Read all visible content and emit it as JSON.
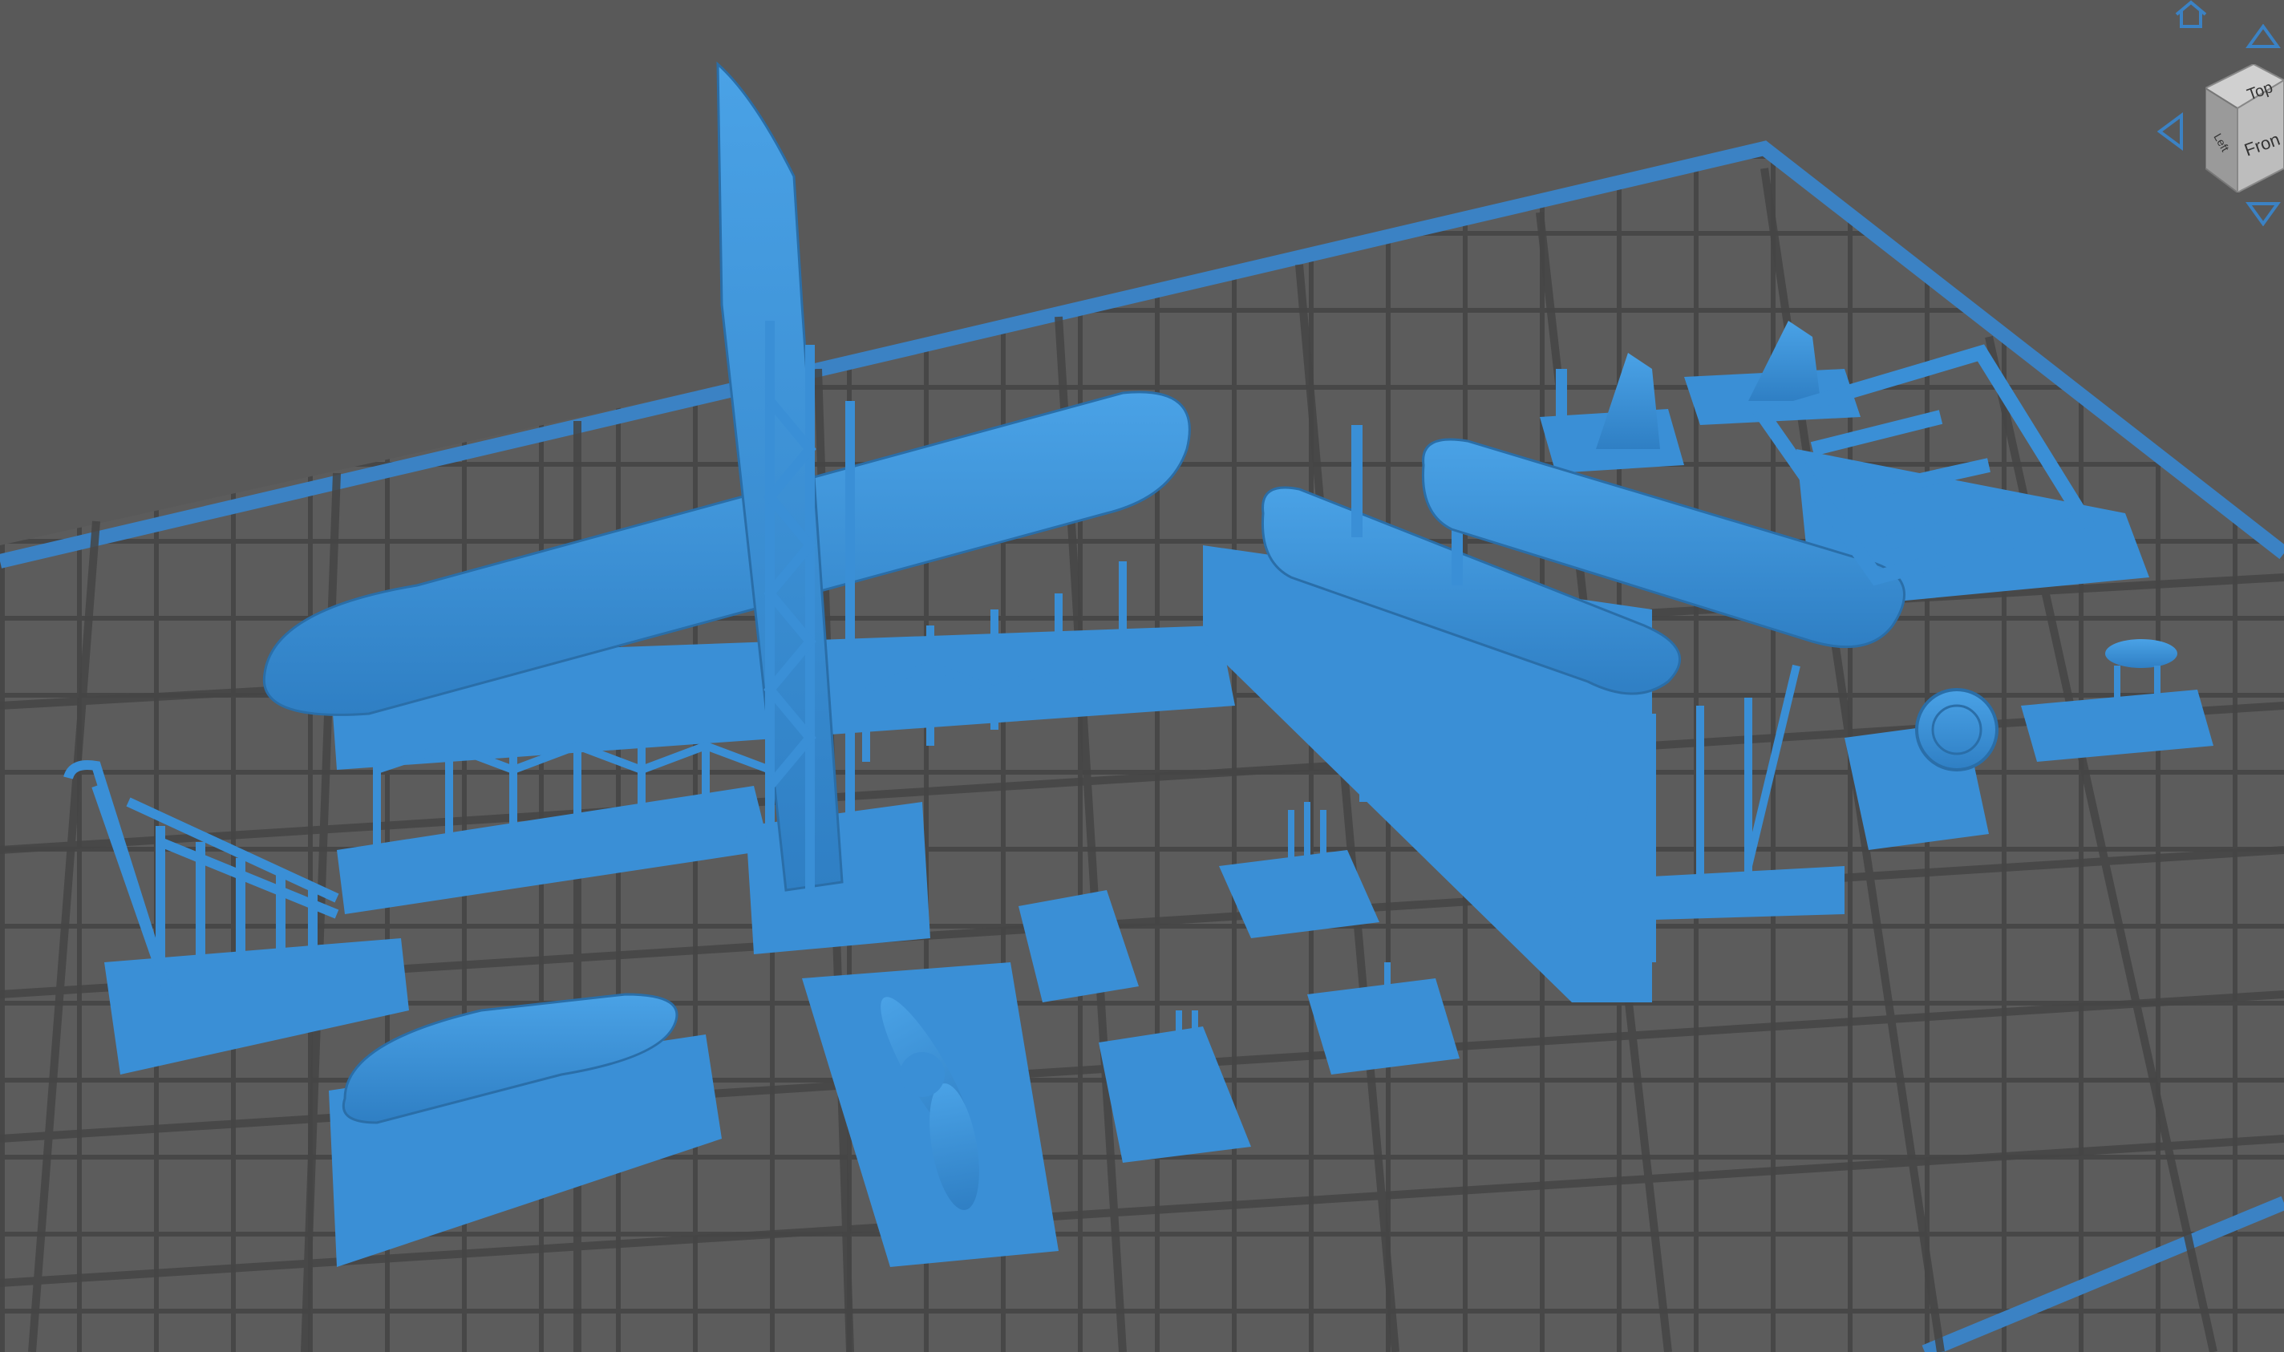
{
  "navigation_cube": {
    "faces": {
      "top": "Top",
      "front": "Fron",
      "left": "Left"
    },
    "buttons": [
      "home-icon",
      "arrow-up-icon",
      "arrow-left-icon",
      "arrow-down-icon"
    ]
  },
  "colors": {
    "background": "#595959",
    "build_plate_grid": "#4a4a4a",
    "build_plate_border": "#3f7fb8",
    "model": "#3a8fd6",
    "model_shadow": "#2a6ea8",
    "support_raft": "#3a8fd6"
  },
  "scene": {
    "view": "perspective",
    "objects": [
      "fuselage-tall",
      "wing-main",
      "ladder",
      "wing-tip",
      "propeller",
      "small-part-1",
      "small-part-2",
      "small-part-3",
      "small-part-4",
      "engine-nacelle-left",
      "engine-nacelle-right",
      "bracket-1",
      "bracket-2",
      "frame-assembly",
      "radial-engine",
      "tail-wheel"
    ]
  }
}
